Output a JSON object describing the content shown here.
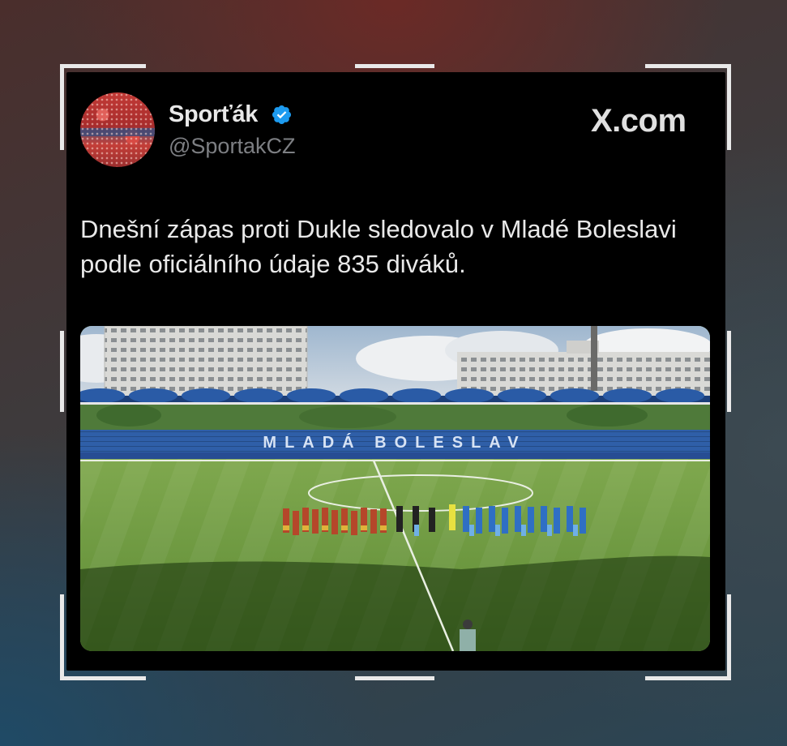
{
  "tweet": {
    "display_name": "Sporťák",
    "handle": "@SportakCZ",
    "site_logo": "X.com",
    "text": "Dnešní zápas proti Dukle sledovalo v Mladé Boleslavi podle oficiálního údaje 835 diváků.",
    "verified": true
  },
  "icons": {
    "verified": "verified-badge-icon",
    "x_logo": "x-logo-icon"
  },
  "colors": {
    "verified_blue": "#1d9bf0",
    "card_bg": "#000000",
    "text_primary": "#e9e9e9",
    "text_secondary": "#7d7f83"
  },
  "media": {
    "stand_letters": "MLADÁ BOLESLAV"
  }
}
